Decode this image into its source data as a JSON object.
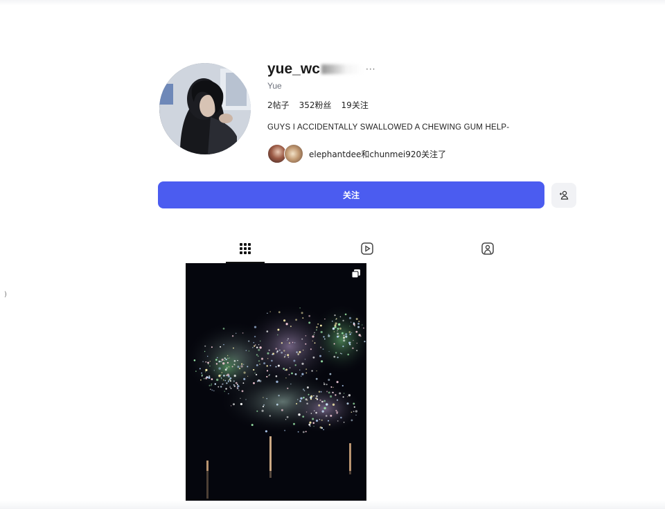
{
  "profile": {
    "username_visible": "yue_wc",
    "more_dots": "···",
    "display_name": "Yue",
    "stats": {
      "posts": "2帖子",
      "followers": "352粉丝",
      "following": "19关注"
    },
    "bio": "GUYS I ACCIDENTALLY SWALLOWED A CHEWING GUM HELP-",
    "followed_by": "elephantdee和chunmei920关注了"
  },
  "actions": {
    "follow_label": "关注",
    "suggest_icon": "person-add-icon"
  },
  "tabs": [
    {
      "icon": "grid-icon",
      "active": true
    },
    {
      "icon": "reels-icon",
      "active": false
    },
    {
      "icon": "tagged-icon",
      "active": false
    }
  ],
  "posts": [
    {
      "type": "carousel",
      "subject": "fireworks"
    }
  ],
  "colors": {
    "accent": "#4b5cf0",
    "text": "#111111",
    "muted": "#6b6f7a",
    "button_secondary": "#f1f2f5"
  }
}
